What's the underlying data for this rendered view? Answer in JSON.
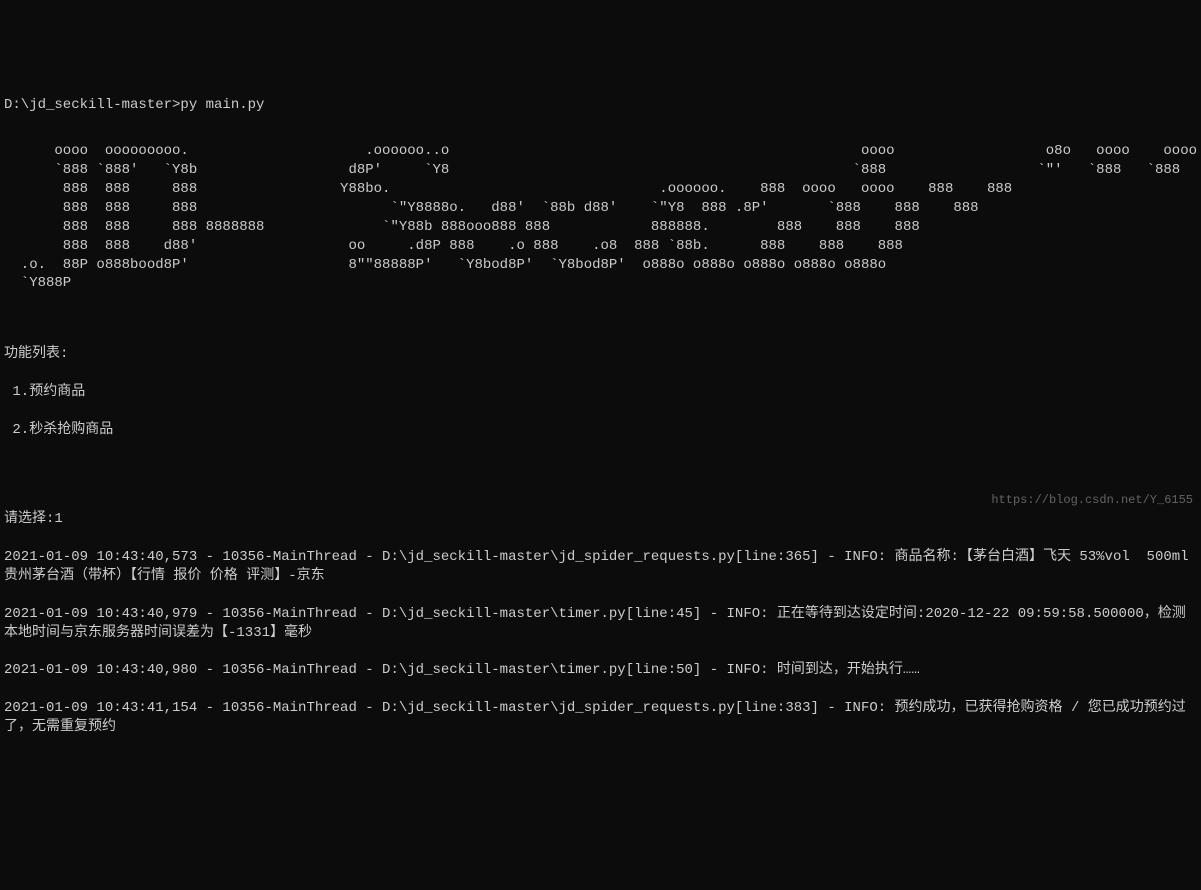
{
  "prompt": "D:\\jd_seckill-master>py main.py",
  "ascii": "      oooo  ooooooooo.                     .oooooo..o                                                 oooo                  o8o   oooo    oooo\n      `888 `888'   `Y8b                  d8P'     `Y8                                                `888                  `\"'   `888   `888\n       888  888     888                 Y88bo.                                .oooooo.    888  oooo   oooo    888    888\n       888  888     888                       `\"Y8888o.   d88'  `88b d88'    `\"Y8  888 .8P'       `888    888    888\n       888  888     888 8888888              `\"Y88b 888ooo888 888            888888.        888    888    888\n       888  888    d88'                  oo     .d8P 888    .o 888    .o8  888 `88b.      888    888    888\n  .o.  88P o888bood8P'                   8\"\"88888P'   `Y8bod8P'  `Y8bod8P'  o888o o888o o888o o888o o888o\n  `Y888P",
  "menuHeader": "功能列表:",
  "menuItem1": " 1.预约商品",
  "menuItem2": " 2.秒杀抢购商品",
  "selectPrompt": "请选择:1",
  "log1": "2021-01-09 10:43:40,573 - 10356-MainThread - D:\\jd_seckill-master\\jd_spider_requests.py[line:365] - INFO: 商品名称:【茅台白酒】飞天 53%vol  500ml 贵州茅台酒（带杯）【行情 报价 价格 评测】-京东",
  "log2": "2021-01-09 10:43:40,979 - 10356-MainThread - D:\\jd_seckill-master\\timer.py[line:45] - INFO: 正在等待到达设定时间:2020-12-22 09:59:58.500000，检测本地时间与京东服务器时间误差为【-1331】毫秒",
  "log3": "2021-01-09 10:43:40,980 - 10356-MainThread - D:\\jd_seckill-master\\timer.py[line:50] - INFO: 时间到达，开始执行……",
  "log4": "2021-01-09 10:43:41,154 - 10356-MainThread - D:\\jd_seckill-master\\jd_spider_requests.py[line:383] - INFO: 预约成功，已获得抢购资格 / 您已成功预约过了，无需重复预约",
  "watermark": "https://blog.csdn.net/Y_6155"
}
